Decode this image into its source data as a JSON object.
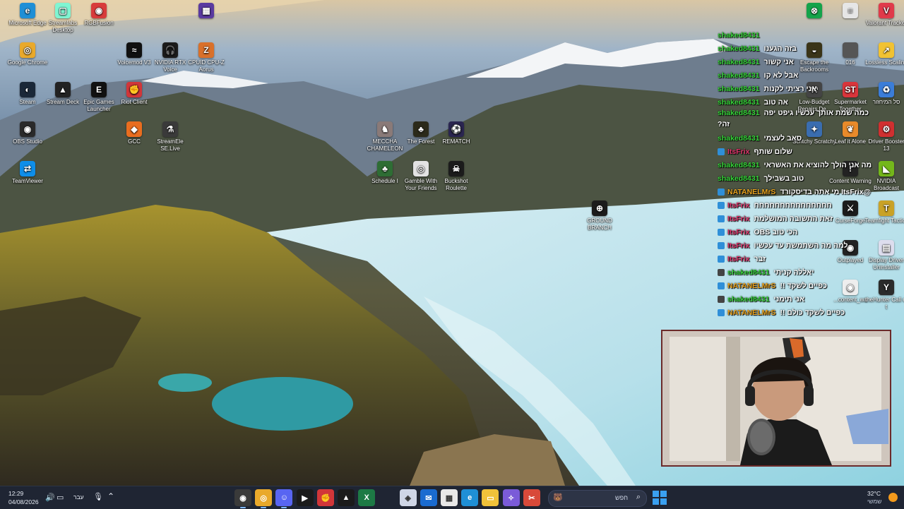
{
  "desktop_icons": [
    {
      "id": "edge",
      "label": "Microsoft Edge",
      "icon": "edge-icon",
      "bg": "#1f8fd6",
      "glyph": "e"
    },
    {
      "id": "streamlabs",
      "label": "Streamlabs Desktop",
      "icon": "streamlabs-icon",
      "bg": "#80f5d2",
      "glyph": "▢"
    },
    {
      "id": "rgbfusion",
      "label": "RGBFusion",
      "icon": "rgbfusion-icon",
      "bg": "#d83b3b",
      "glyph": "◉"
    },
    {
      "id": "chrome",
      "label": "Google Chrome",
      "icon": "chrome-icon",
      "bg": "#e9a92b",
      "glyph": "◎"
    },
    {
      "id": "voicemod",
      "label": "Voicemod V3",
      "icon": "voicemod-icon",
      "bg": "#101010",
      "glyph": "≈"
    },
    {
      "id": "nvidia_voice",
      "label": "NVIDIA RTX Voice",
      "icon": "nvidia-rtx-voice-icon",
      "bg": "#1b1b1b",
      "glyph": "🎧"
    },
    {
      "id": "cpuid",
      "label": "CPUID CPU-Z Aorus",
      "icon": "cpuz-icon",
      "bg": "#d9702a",
      "glyph": "Z"
    },
    {
      "id": "steam",
      "label": "Steam",
      "icon": "steam-icon",
      "bg": "#1b2838",
      "glyph": "◐"
    },
    {
      "id": "streamdeck",
      "label": "Stream Deck",
      "icon": "stream-deck-icon",
      "bg": "#222",
      "glyph": "▲"
    },
    {
      "id": "epic",
      "label": "Epic Games Launcher",
      "icon": "epic-games-icon",
      "bg": "#111",
      "glyph": "E"
    },
    {
      "id": "riot",
      "label": "Riot Client",
      "icon": "riot-client-icon",
      "bg": "#d13639",
      "glyph": "✊"
    },
    {
      "id": "obs",
      "label": "OBS Studio",
      "icon": "obs-icon",
      "bg": "#2a2a2a",
      "glyph": "◉"
    },
    {
      "id": "gcc",
      "label": "GCC",
      "icon": "gcc-icon",
      "bg": "#e96d1f",
      "glyph": "◆"
    },
    {
      "id": "streamelements",
      "label": "StreamEle SE.Live",
      "icon": "streamelements-icon",
      "bg": "#3a3a3a",
      "glyph": "⚗"
    },
    {
      "id": "teamviewer",
      "label": "TeamViewer",
      "icon": "teamviewer-icon",
      "bg": "#0e8ee9",
      "glyph": "⇄"
    },
    {
      "id": "meccha",
      "label": "MECCHA CHAMELEON",
      "icon": "meccha-chameleon-icon",
      "bg": "#8a7a78",
      "glyph": "♞"
    },
    {
      "id": "theforest",
      "label": "The Forest",
      "icon": "the-forest-icon",
      "bg": "#2b2a1a",
      "glyph": "♣"
    },
    {
      "id": "rematch",
      "label": "REMATCH",
      "icon": "rematch-icon",
      "bg": "#2a2550",
      "glyph": "⚽"
    },
    {
      "id": "schedule",
      "label": "Schedule I",
      "icon": "schedule-i-icon",
      "bg": "#2e6d34",
      "glyph": "♣"
    },
    {
      "id": "gamble",
      "label": "Gamble With Your Friends",
      "icon": "gamble-icon",
      "bg": "#e3e3e3",
      "glyph": "◎"
    },
    {
      "id": "buckshot",
      "label": "Buckshot Roulette",
      "icon": "buckshot-roulette-icon",
      "bg": "#1b1b1b",
      "glyph": "☠"
    },
    {
      "id": "groundbranch",
      "label": "GROUND BRANCH",
      "icon": "ground-branch-icon",
      "bg": "#1b1b1b",
      "glyph": "⊕"
    },
    {
      "id": "toppurple",
      "label": "",
      "icon": "app-icon",
      "bg": "#5a3aa0",
      "glyph": "▦"
    }
  ],
  "right_icons": [
    {
      "label": "",
      "icon": "xbox-icon",
      "bg": "#14a34a",
      "glyph": "⊗"
    },
    {
      "label": "",
      "icon": "document-icon",
      "bg": "#e6e6e6",
      "glyph": "≡"
    },
    {
      "label": "Valorant Tracker",
      "icon": "valorant-tracker-icon",
      "bg": "#e03a4a",
      "glyph": "V"
    },
    {
      "label": "Escape the Backrooms",
      "icon": "escape-backrooms-icon",
      "bg": "#3a3418",
      "glyph": "◒"
    },
    {
      "label": "016",
      "icon": "folder-icon",
      "bg": "#555",
      "glyph": ""
    },
    {
      "label": "Lossless Scaling",
      "icon": "lossless-scaling-icon",
      "bg": "#f1c232",
      "glyph": "↗"
    },
    {
      "label": "Low-Budget Repairs De...",
      "icon": "low-budget-repairs-icon",
      "bg": "#444",
      "glyph": "⚒"
    },
    {
      "label": "Supermarket Together",
      "icon": "supermarket-together-icon",
      "bg": "#d9353b",
      "glyph": "ST"
    },
    {
      "label": "סל המיחזור",
      "icon": "recycle-bin-icon",
      "bg": "#3b7dd8",
      "glyph": "♻"
    },
    {
      "label": "Scritchy Scratchy",
      "icon": "scritchy-scratchy-icon",
      "bg": "#3a6db0",
      "glyph": "✦"
    },
    {
      "label": "Leaf it Alone",
      "icon": "leaf-it-alone-icon",
      "bg": "#e88a2a",
      "glyph": "❦"
    },
    {
      "label": "Driver Booster 13",
      "icon": "driver-booster-icon",
      "bg": "#d03030",
      "glyph": "⚙"
    },
    {
      "label": "Content Warning",
      "icon": "content-warning-icon",
      "bg": "#222",
      "glyph": "!"
    },
    {
      "label": "NVIDIA Broadcast",
      "icon": "nvidia-broadcast-icon",
      "bg": "#74b71b",
      "glyph": "◣"
    },
    {
      "label": "CurseForge",
      "icon": "curseforge-icon",
      "bg": "#1b1b1b",
      "glyph": "⚔"
    },
    {
      "label": "Teamfight Tactics",
      "icon": "teamfight-tactics-icon",
      "bg": "#c9a227",
      "glyph": "T"
    },
    {
      "label": "Outplayed",
      "icon": "outplayed-icon",
      "bg": "#222",
      "glyph": "◉"
    },
    {
      "label": "Display Driver Uninstaller",
      "icon": "ddu-icon",
      "bg": "#dde",
      "glyph": "▤"
    },
    {
      "label": "...content_wa",
      "icon": "content-wa-icon",
      "bg": "#eee",
      "glyph": "◉"
    },
    {
      "label": "theHunter Call of t",
      "icon": "thehunter-icon",
      "bg": "#2b2b2b",
      "glyph": "Y"
    }
  ],
  "chat": [
    {
      "user": "shaked8431",
      "color": "#37d43a",
      "badge": "",
      "text": ""
    },
    {
      "user": "shaked8431",
      "color": "#37d43a",
      "badge": "",
      "text": "בזה הגענו"
    },
    {
      "user": "shaked8431",
      "color": "#37d43a",
      "badge": "",
      "text": "אני קשור"
    },
    {
      "user": "shaked8431",
      "color": "#37d43a",
      "badge": "",
      "text": "אבל לא קו"
    },
    {
      "user": "shaked8431",
      "color": "#37d43a",
      "badge": "",
      "text": "אני רציתי לקנות"
    },
    {
      "user": "shaked8431",
      "color": "#37d43a",
      "badge": "",
      "text": "אה טוב"
    },
    {
      "user": "shaked8431",
      "color": "#37d43a",
      "badge": "",
      "text": "כמה שמת אותך עכשיו גיפט יפה",
      "extra": "?זה"
    },
    {
      "user": "shaked8431",
      "color": "#37d43a",
      "badge": "",
      "text": "סאב לעצמי"
    },
    {
      "user": "ItsFrix",
      "color": "#e0336a",
      "badge": "#2f8fd8",
      "text": "שלום שותף"
    },
    {
      "user": "shaked8431",
      "color": "#37d43a",
      "badge": "",
      "text": "מה אני הולך להוציא את האשראי"
    },
    {
      "user": "shaked8431",
      "color": "#37d43a",
      "badge": "",
      "text": "טוב בשבילך"
    },
    {
      "user": "NATANELMrS",
      "color": "#e8a21e",
      "badge": "#2f8fd8",
      "text": "@ItsFrix מי אתה בדיסקורד"
    },
    {
      "user": "ItsFrix",
      "color": "#e0336a",
      "badge": "#2f8fd8",
      "text": "חחחחחחחחחחחחחחח"
    },
    {
      "user": "ItsFrix",
      "color": "#e0336a",
      "badge": "#2f8fd8",
      "text": "זאת התשובה המושלמת"
    },
    {
      "user": "ItsFrix",
      "color": "#e0336a",
      "badge": "#2f8fd8",
      "text": "הכי טוב OBS"
    },
    {
      "user": "ItsFrix",
      "color": "#e0336a",
      "badge": "#2f8fd8",
      "text": "למה מה השתמשת עד עכשיו"
    },
    {
      "user": "ItsFrix",
      "color": "#e0336a",
      "badge": "#2f8fd8",
      "text": "זבר"
    },
    {
      "user": "shaked8431",
      "color": "#37d43a",
      "badge": "#444",
      "text": "יאללה קניתי"
    },
    {
      "user": "NATANELMrS",
      "color": "#e8a21e",
      "badge": "#2f8fd8",
      "text": "כפיים לשקד !!"
    },
    {
      "user": "shaked8431",
      "color": "#37d43a",
      "badge": "#444",
      "text": "אני תימני"
    },
    {
      "user": "NATANELMrS",
      "color": "#e8a21e",
      "badge": "#2f8fd8",
      "text": "כפיים לשקד כולם !!"
    }
  ],
  "taskbar": {
    "time": "12:29",
    "date": "04/08/2026",
    "language": "עבר",
    "search_placeholder": "חפש",
    "weather_temp": "32°C",
    "weather_desc": "שמשי",
    "apps": [
      {
        "name": "obs-taskbar-icon",
        "bg": "#3a3a3a",
        "glyph": "◉",
        "active": true
      },
      {
        "name": "chrome-taskbar-icon",
        "bg": "#e9a92b",
        "glyph": "◎",
        "active": true
      },
      {
        "name": "discord-taskbar-icon",
        "bg": "#5865f2",
        "glyph": "☺",
        "active": true
      },
      {
        "name": "nvidia-taskbar-icon",
        "bg": "#1b1b1b",
        "glyph": "▶",
        "active": false
      },
      {
        "name": "riot-taskbar-icon",
        "bg": "#d13639",
        "glyph": "✊",
        "active": false
      },
      {
        "name": "stream-deck-taskbar-icon",
        "bg": "#1b1b1b",
        "glyph": "▲",
        "active": false
      },
      {
        "name": "excel-taskbar-icon",
        "bg": "#1d7a45",
        "glyph": "X",
        "active": false
      },
      {
        "name": "unknown-taskbar-icon",
        "bg": "#1f2533",
        "glyph": "",
        "active": false
      },
      {
        "name": "cube-taskbar-icon",
        "bg": "#cfd6e6",
        "glyph": "◈",
        "active": false
      },
      {
        "name": "outlook-taskbar-icon",
        "bg": "#1a6bd0",
        "glyph": "✉",
        "active": false
      },
      {
        "name": "store-taskbar-icon",
        "bg": "#e8e8e8",
        "glyph": "▦",
        "active": false
      },
      {
        "name": "edge-taskbar-icon",
        "bg": "#1f8fd6",
        "glyph": "e",
        "active": false
      },
      {
        "name": "explorer-taskbar-icon",
        "bg": "#f0c23a",
        "glyph": "▭",
        "active": false
      },
      {
        "name": "copilot-taskbar-icon",
        "bg": "#7a5bd8",
        "glyph": "✧",
        "active": false
      },
      {
        "name": "snipping-taskbar-icon",
        "bg": "#d84a3a",
        "glyph": "✂",
        "active": false
      }
    ]
  }
}
